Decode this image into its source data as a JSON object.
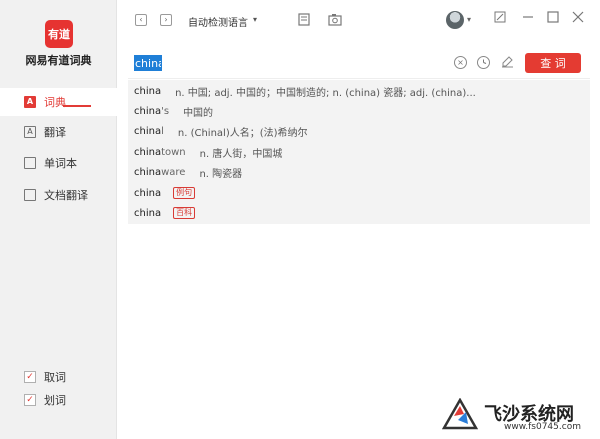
{
  "app": {
    "logo_text": "有道",
    "name": "网易有道词典"
  },
  "sidebar": {
    "items": [
      {
        "label": "词典",
        "icon": "A"
      },
      {
        "label": "翻译",
        "icon": "A"
      },
      {
        "label": "单词本",
        "icon": ""
      },
      {
        "label": "文档翻译",
        "icon": ""
      }
    ],
    "options": [
      {
        "label": "取词",
        "checked": "✓"
      },
      {
        "label": "划词",
        "checked": "✓"
      }
    ]
  },
  "topbar": {
    "back": "‹",
    "forward": "›",
    "language": "自动检测语言",
    "language_arrow": "▾",
    "avatar_arrow": "▾"
  },
  "search": {
    "value": "china",
    "clear_icon": "×",
    "query_label": "查 词"
  },
  "suggestions": [
    {
      "word": "china",
      "rest": "",
      "def": "n. 中国; adj. 中国的；中国制造的; n. (china) 瓷器; adj. (china)..."
    },
    {
      "word": "china",
      "rest": "'s",
      "def": "中国的"
    },
    {
      "word": "china",
      "rest": "l",
      "def": "n. (Chinal)人名；(法)希纳尔"
    },
    {
      "word": "china",
      "rest": "town",
      "def": "n. 唐人街，中国城"
    },
    {
      "word": "china",
      "rest": "ware",
      "def": "n. 陶瓷器"
    },
    {
      "word": "china",
      "tag": "例句"
    },
    {
      "word": "china",
      "tag": "百科"
    }
  ],
  "watermark": {
    "title": "飞沙系统网",
    "url": "www.fs0745.com"
  },
  "colors": {
    "accent": "#e43b32",
    "selection": "#1f7fd7"
  }
}
